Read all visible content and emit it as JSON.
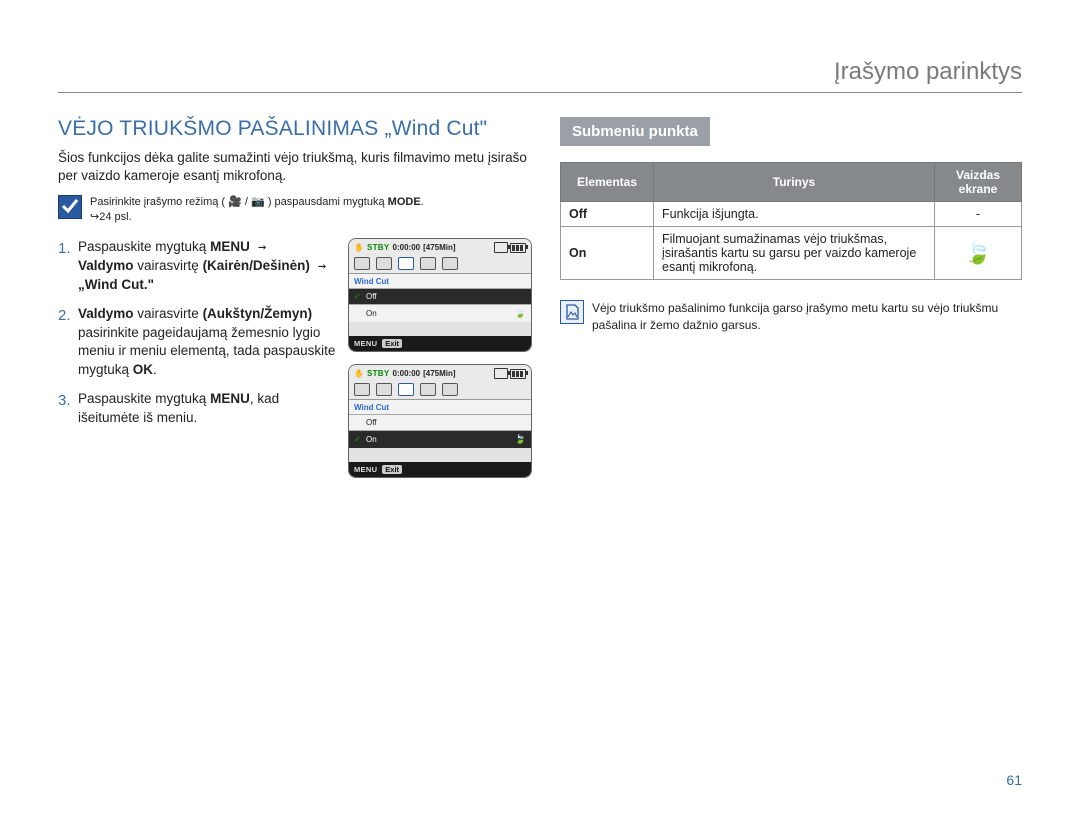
{
  "header": {
    "section": "Įrašymo parinktys"
  },
  "title": "VĖJO TRIUKŠMO PAŠALINIMAS „Wind Cut\"",
  "intro": "Šios funkcijos dėka galite sumažinti vėjo triukšmą, kuris filmavimo metu įsirašo per vaizdo kameroje esantį mikrofoną.",
  "precheck": {
    "text_a": "Pasirinkite įrašymo režimą (",
    "text_b": " / ",
    "text_c": " ) paspausdami mygtuką ",
    "mode": "MODE",
    "page_ref": "24 psl."
  },
  "steps": {
    "s1a": "Paspauskite mygtuką ",
    "s1_menu": "MENU",
    "s1_arrow": " → ",
    "s1b": "Valdymo",
    "s1c": " vairasvirtę ",
    "s1d": "(Kairėn/Dešinėn)",
    "s1_arrow2": " → ",
    "s1e": "„Wind Cut.\"",
    "s2a": "Valdymo",
    "s2b": " vairasvirte ",
    "s2c": "(Aukštyn/Žemyn)",
    "s2d": " pasirinkite pageidaujamą žemesnio lygio meniu ir meniu elementą, tada paspauskite mygtuką ",
    "s2_ok": "OK",
    "s2_dot": ".",
    "s3a": "Paspauskite mygtuką ",
    "s3_menu": "MENU",
    "s3b": ", kad išeitumėte iš meniu."
  },
  "cam": {
    "stby": "STBY",
    "time": "0:00:00",
    "remain": "[475Min]",
    "label": "Wind Cut",
    "off": "Off",
    "on": "On",
    "menu": "MENU",
    "exit": "Exit"
  },
  "right": {
    "subhead": "Submeniu punkta",
    "th_el": "Elementas",
    "th_cont": "Turinys",
    "th_disp1": "Vaizdas",
    "th_disp2": "ekrane",
    "row_off_el": "Off",
    "row_off_cont": "Funkcija išjungta.",
    "row_off_disp": "-",
    "row_on_el": "On",
    "row_on_cont": "Filmuojant sumažinamas vėjo triukšmas, įsirašantis kartu su garsu per vaizdo kameroje esantį mikrofoną."
  },
  "note": "Vėjo triukšmo pašalinimo funkcija garso įrašymo metu kartu su vėjo triukšmu pašalina ir žemo dažnio garsus.",
  "page_number": "61"
}
